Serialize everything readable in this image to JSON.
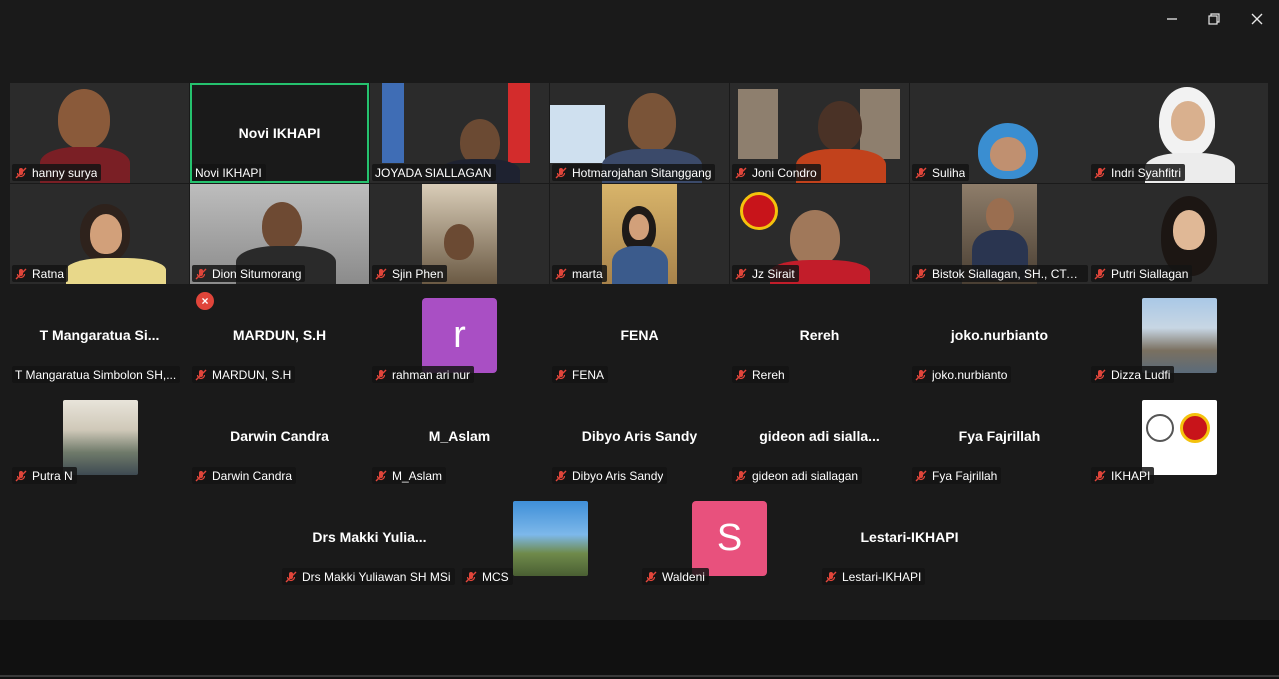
{
  "window": {
    "minimize_icon": "minimize-icon",
    "restore_icon": "restore-icon",
    "close_icon": "close-icon"
  },
  "gallery": {
    "row1": [
      {
        "name": "hanny surya"
      },
      {
        "name": "Novi IKHAPI",
        "center": "Novi IKHAPI"
      },
      {
        "name": "JOYADA SIALLAGAN"
      },
      {
        "name": "Hotmarojahan Sitanggang"
      },
      {
        "name": "Joni Condro"
      },
      {
        "name": "Suliha"
      },
      {
        "name": "Indri Syahfitri"
      }
    ],
    "row2": [
      {
        "name": "Ratna"
      },
      {
        "name": "Dion Situmorang"
      },
      {
        "name": "Sjin Phen"
      },
      {
        "name": "marta"
      },
      {
        "name": "Jz Sirait"
      },
      {
        "name": "Bistok Siallagan, SH., CTA, ..."
      },
      {
        "name": "Putri Siallagan"
      }
    ],
    "row3": [
      {
        "name": "T Mangaratua Simbolon SH,...",
        "center": "T  Mangaratua  Si..."
      },
      {
        "name": "MARDUN, S.H",
        "center": "MARDUN, S.H"
      },
      {
        "name": "rahman ari nur",
        "avatar": "r"
      },
      {
        "name": "FENA",
        "center": "FENA"
      },
      {
        "name": "Rereh",
        "center": "Rereh"
      },
      {
        "name": "joko.nurbianto",
        "center": "joko.nurbianto"
      },
      {
        "name": "Dizza Ludfi"
      }
    ],
    "row4": [
      {
        "name": "Putra N"
      },
      {
        "name": "Darwin Candra",
        "center": "Darwin Candra"
      },
      {
        "name": "M_Aslam",
        "center": "M_Aslam"
      },
      {
        "name": "Dibyo Aris Sandy",
        "center": "Dibyo Aris Sandy"
      },
      {
        "name": "gideon adi siallagan",
        "center": "gideon  adi  sialla..."
      },
      {
        "name": "Fya Fajrillah",
        "center": "Fya Fajrillah"
      },
      {
        "name": "IKHAPI"
      }
    ],
    "row5": [
      {
        "name": "Drs Makki Yuliawan SH MSi",
        "center": "Drs  Makki  Yulia..."
      },
      {
        "name": "MCS"
      },
      {
        "name": "Waldeni",
        "avatar": "S"
      },
      {
        "name": "Lestari-IKHAPI",
        "center": "Lestari-IKHAPI"
      }
    ],
    "close_badge": "×"
  },
  "colors": {
    "active_speaker": "#25c26e",
    "muted_icon": "#e0453a",
    "avatar_r": "#a94fc4",
    "avatar_s": "#e8517d"
  }
}
